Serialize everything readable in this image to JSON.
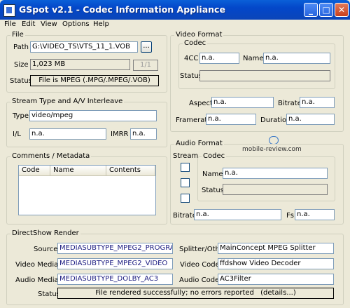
{
  "window": {
    "title": "GSpot v2.1 - Codec Information Appliance"
  },
  "menu": {
    "file": "File",
    "edit": "Edit",
    "view": "View",
    "options": "Options",
    "help": "Help"
  },
  "file_group": {
    "title": "File",
    "path_label": "Path",
    "path_value": "G:\\VIDEO_TS\\VTS_11_1.VOB",
    "browse_label": "...",
    "size_label": "Size",
    "size_value": "1,023 MB",
    "part_value": "1/1",
    "status_label": "Status",
    "status_value": "File is MPEG (.MPG/.MPEG/.VOB)"
  },
  "stream_group": {
    "title": "Stream Type and A/V Interleave",
    "type_label": "Type",
    "type_value": "video/mpeg",
    "il_label": "I/L",
    "il_value": "n.a.",
    "imrr_label": "IMRR",
    "imrr_value": "n.a."
  },
  "comments_group": {
    "title": "Comments / Metadata",
    "columns": [
      "Code",
      "Name",
      "Contents"
    ]
  },
  "video_format": {
    "title": "Video Format",
    "codec_title": "Codec",
    "fourcc_label": "4CC",
    "fourcc_value": "n.a.",
    "name_label": "Name",
    "name_value": "n.a.",
    "status_label": "Status",
    "status_value": "",
    "aspect_label": "Aspect",
    "aspect_value": "n.a.",
    "bitrate_label": "Bitrate",
    "bitrate_value": "n.a.",
    "framerate_label": "Framerate",
    "framerate_value": "n.a.",
    "duration_label": "Duration",
    "duration_value": "n.a."
  },
  "audio_format": {
    "title": "Audio Format",
    "stream_label": "Stream",
    "codec_title": "Codec",
    "name_label": "Name",
    "name_value": "n.a.",
    "status_label": "Status",
    "status_value": "",
    "bitrate_label": "Bitrate",
    "bitrate_value": "n.a.",
    "fs_label": "Fs",
    "fs_value": "n.a."
  },
  "watermark": "mobile-review.com",
  "directshow": {
    "title": "DirectShow Render",
    "source_label": "Source",
    "source_value": "MEDIASUBTYPE_MPEG2_PROGRA",
    "splitter_label": "Splitter/Other",
    "splitter_value": "MainConcept MPEG Splitter",
    "video_media_label": "Video Media",
    "video_media_value": "MEDIASUBTYPE_MPEG2_VIDEO",
    "video_codec_label": "Video Codec",
    "video_codec_value": "ffdshow Video Decoder",
    "audio_media_label": "Audio Media",
    "audio_media_value": "MEDIASUBTYPE_DOLBY_AC3",
    "audio_codec_label": "Audio Codec",
    "audio_codec_value": "AC3Filter",
    "status_label": "Status",
    "status_value": "File rendered successfully; no errors reported",
    "details_label": "(details...)"
  }
}
